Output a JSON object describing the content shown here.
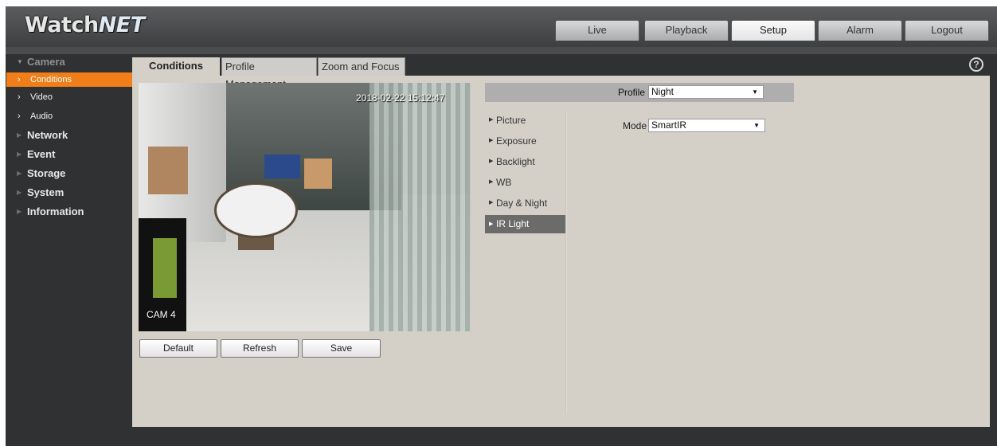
{
  "brand": {
    "logo_prefix": "Watch",
    "logo_suffix": "NET"
  },
  "nav": {
    "tabs": [
      {
        "label": "Live"
      },
      {
        "label": "Playback"
      },
      {
        "label": "Setup"
      },
      {
        "label": "Alarm"
      },
      {
        "label": "Logout"
      }
    ],
    "active": "Setup"
  },
  "sidebar": {
    "camera": "Camera",
    "camera_items": [
      {
        "label": "Conditions"
      },
      {
        "label": "Video"
      },
      {
        "label": "Audio"
      }
    ],
    "sections": [
      {
        "label": "Network"
      },
      {
        "label": "Event"
      },
      {
        "label": "Storage"
      },
      {
        "label": "System"
      },
      {
        "label": "Information"
      }
    ]
  },
  "content_tabs": [
    {
      "label": "Conditions"
    },
    {
      "label": "Profile Management"
    },
    {
      "label": "Zoom and Focus"
    }
  ],
  "help_icon": "help-icon",
  "video": {
    "timestamp": "2018-02-22 15:12:47",
    "camera_name": "CAM 4"
  },
  "buttons": {
    "default": "Default",
    "refresh": "Refresh",
    "save": "Save"
  },
  "profile": {
    "label": "Profile",
    "value": "Night"
  },
  "submenu": [
    {
      "label": "Picture"
    },
    {
      "label": "Exposure"
    },
    {
      "label": "Backlight"
    },
    {
      "label": "WB"
    },
    {
      "label": "Day & Night"
    },
    {
      "label": "IR Light"
    }
  ],
  "submenu_active": "IR Light",
  "mode": {
    "label": "Mode",
    "value": "SmartIR"
  },
  "colors": {
    "accent": "#f27e1a",
    "frame": "#2f3132",
    "panel": "#d4d0c8",
    "active_submenu": "#6b6b6b"
  }
}
